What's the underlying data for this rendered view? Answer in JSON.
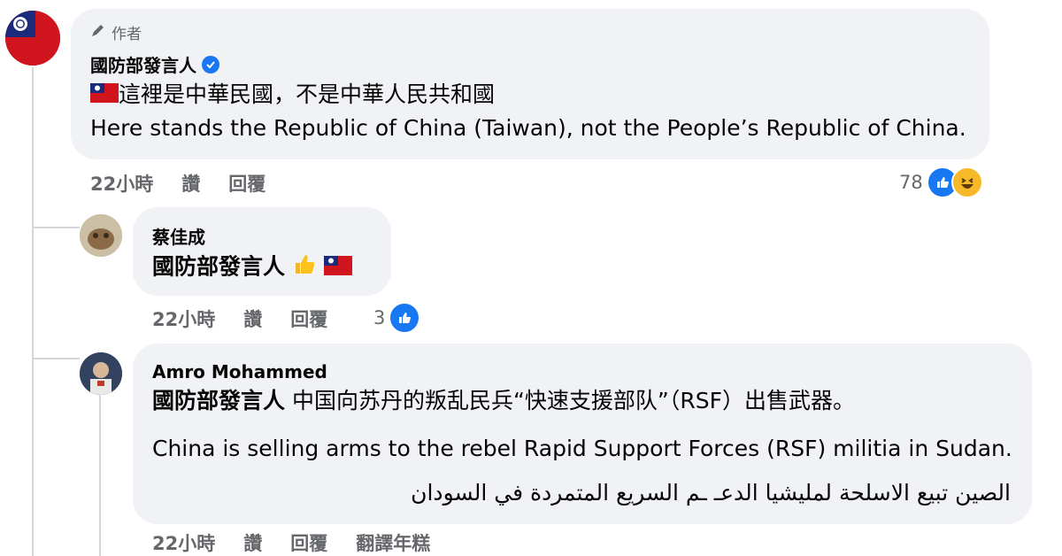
{
  "comments": [
    {
      "badge": "作者",
      "name": "國防部發言人",
      "line1": "這裡是中華民國，不是中華人民共和國",
      "line2": "Here stands the Republic of China (Taiwan), not the People’s Republic of China.",
      "time": "22小時",
      "like": "讚",
      "reply": "回覆",
      "reaction_count": "78"
    },
    {
      "name": "蔡佳成",
      "mention": "國防部發言人",
      "time": "22小時",
      "like": "讚",
      "reply": "回覆",
      "reaction_count": "3"
    },
    {
      "name": "Amro Mohammed",
      "mention": "國防部發言人",
      "line1": "中国向苏丹的叛乱民兵“快速支援部队”（RSF）出售武器。",
      "line2": "China is selling arms to the rebel Rapid Support Forces (RSF) militia in Sudan.",
      "line3": "الصين تبيع الاسلحة لمليشيا الدعـ ـم السريع المتمردة في السودان",
      "time": "22小時",
      "like": "讚",
      "reply": "回覆",
      "translate": "翻譯年糕"
    }
  ],
  "colors": {
    "bubble": "#f0f2f5",
    "like_blue": "#1877f2",
    "meta_gray": "#65676b"
  }
}
